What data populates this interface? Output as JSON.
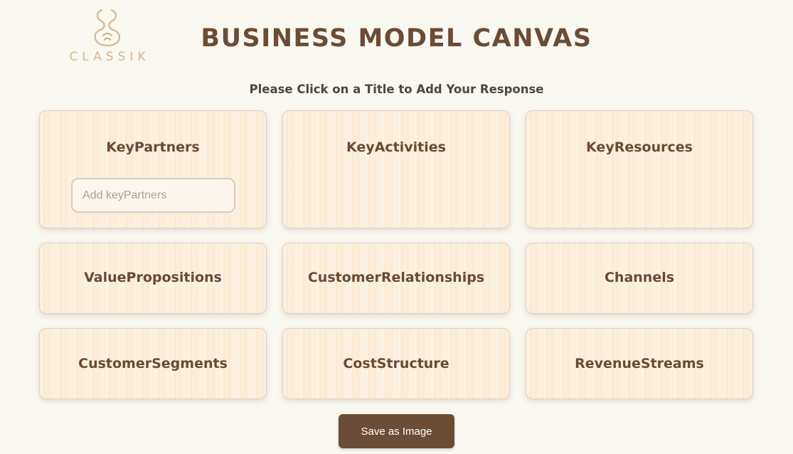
{
  "logo": {
    "text": "CLASSIK",
    "color": "#d3b791"
  },
  "header": {
    "title": "BUSINESS MODEL CANVAS",
    "subtitle": "Please Click on a Title to Add Your Response"
  },
  "cards": [
    {
      "title": "KeyPartners",
      "input_placeholder": "Add keyPartners",
      "input_value": ""
    },
    {
      "title": "KeyActivities"
    },
    {
      "title": "KeyResources"
    },
    {
      "title": "ValuePropositions"
    },
    {
      "title": "CustomerRelationships"
    },
    {
      "title": "Channels"
    },
    {
      "title": "CustomerSegments"
    },
    {
      "title": "CostStructure"
    },
    {
      "title": "RevenueStreams"
    }
  ],
  "actions": {
    "save_label": "Save as Image"
  },
  "colors": {
    "brand_brown": "#6b4c35",
    "background": "#f9f8f1",
    "card_background": "#fcefdc"
  }
}
